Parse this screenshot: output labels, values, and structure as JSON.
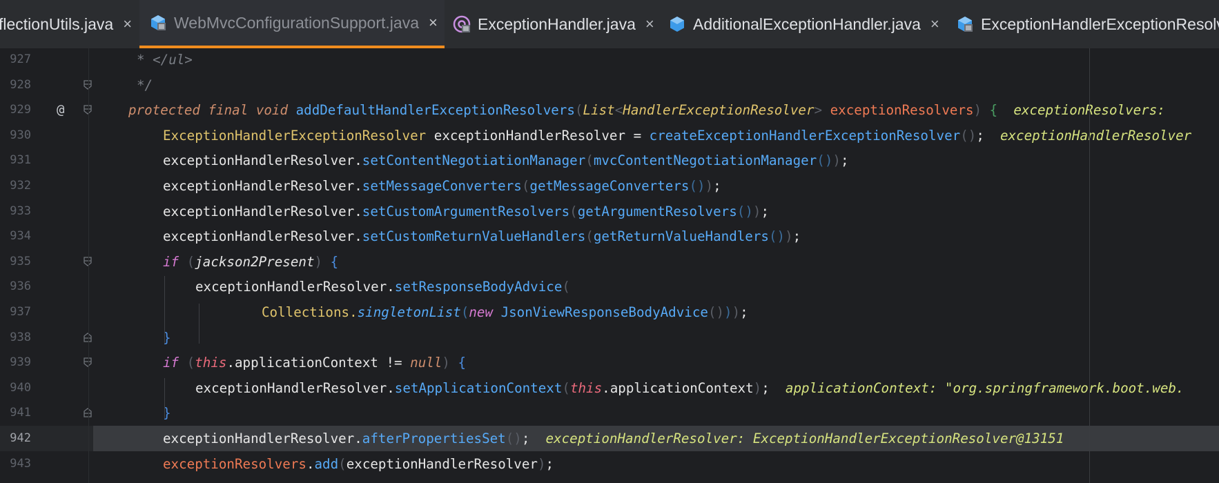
{
  "tabs": [
    {
      "label": "flectionUtils.java",
      "icon": "java-class-icon",
      "active": false
    },
    {
      "label": "WebMvcConfigurationSupport.java",
      "icon": "java-class-icon",
      "active": true
    },
    {
      "label": "ExceptionHandler.java",
      "icon": "annotation-icon",
      "active": false
    },
    {
      "label": "AdditionalExceptionHandler.java",
      "icon": "java-class-icon",
      "active": false
    },
    {
      "label": "ExceptionHandlerExceptionResolve",
      "icon": "java-class-icon",
      "active": false
    }
  ],
  "tab_close_glyph": "×",
  "colors": {
    "accent": "#f08c1e",
    "background": "#1e1f22",
    "current_line": "#393b3f"
  },
  "lines": [
    {
      "number": "927",
      "tokens": [
        [
          "comment",
          "* </ul>"
        ]
      ]
    },
    {
      "number": "928",
      "tokens": [
        [
          "comment",
          "*/"
        ]
      ]
    },
    {
      "number": "929",
      "tokens": [
        [
          "kw",
          "protected"
        ],
        [
          "",
          ""
        ],
        [
          "kw",
          " final"
        ],
        [
          "kw",
          " void"
        ],
        [
          "method",
          " addDefaultHandlerExceptionResolvers"
        ],
        [
          "paren",
          "("
        ],
        [
          "typei",
          "List"
        ],
        [
          "paren",
          "<"
        ],
        [
          "typei",
          "HandlerExceptionResolver"
        ],
        [
          "paren",
          "> "
        ],
        [
          "param",
          "exceptionResolvers"
        ],
        [
          "paren",
          ")"
        ],
        [
          "brace2",
          " {"
        ],
        [
          "inline",
          "  exceptionResolvers: "
        ]
      ]
    },
    {
      "number": "930",
      "tokens": [
        [
          "type",
          "ExceptionHandlerExceptionResolver"
        ],
        [
          "ident",
          " exceptionHandlerResolver = "
        ],
        [
          "method",
          "createExceptionHandlerExceptionResolver"
        ],
        [
          "paren",
          "()"
        ],
        [
          "ident",
          ";  "
        ],
        [
          "inline",
          "exceptionHandlerResolver"
        ]
      ]
    },
    {
      "number": "931",
      "tokens": [
        [
          "ident",
          "exceptionHandlerResolver."
        ],
        [
          "method",
          "setContentNegotiationManager"
        ],
        [
          "paren",
          "("
        ],
        [
          "method",
          "mvcContentNegotiationManager"
        ],
        [
          "paren2",
          "()"
        ],
        [
          "paren",
          ")"
        ],
        [
          "ident",
          ";"
        ]
      ]
    },
    {
      "number": "932",
      "tokens": [
        [
          "ident",
          "exceptionHandlerResolver."
        ],
        [
          "method",
          "setMessageConverters"
        ],
        [
          "paren",
          "("
        ],
        [
          "method",
          "getMessageConverters"
        ],
        [
          "paren2",
          "()"
        ],
        [
          "paren",
          ")"
        ],
        [
          "ident",
          ";"
        ]
      ]
    },
    {
      "number": "933",
      "tokens": [
        [
          "ident",
          "exceptionHandlerResolver."
        ],
        [
          "method",
          "setCustomArgumentResolvers"
        ],
        [
          "paren",
          "("
        ],
        [
          "method",
          "getArgumentResolvers"
        ],
        [
          "paren2",
          "()"
        ],
        [
          "paren",
          ")"
        ],
        [
          "ident",
          ";"
        ]
      ]
    },
    {
      "number": "934",
      "tokens": [
        [
          "ident",
          "exceptionHandlerResolver."
        ],
        [
          "method",
          "setCustomReturnValueHandlers"
        ],
        [
          "paren",
          "("
        ],
        [
          "method",
          "getReturnValueHandlers"
        ],
        [
          "paren2",
          "()"
        ],
        [
          "paren",
          ")"
        ],
        [
          "ident",
          ";"
        ]
      ]
    },
    {
      "number": "935",
      "tokens": [
        [
          "kw2",
          "if"
        ],
        [
          "paren",
          " ("
        ],
        [
          "identi",
          "jackson2Present"
        ],
        [
          "paren",
          ")"
        ],
        [
          "brace",
          " {"
        ]
      ]
    },
    {
      "number": "936",
      "tokens": [
        [
          "ident",
          "exceptionHandlerResolver."
        ],
        [
          "method",
          "setResponseBodyAdvice"
        ],
        [
          "paren",
          "("
        ]
      ]
    },
    {
      "number": "937",
      "tokens": [
        [
          "type",
          "Collections."
        ],
        [
          "methodi",
          "singletonList"
        ],
        [
          "paren2",
          "("
        ],
        [
          "kw2",
          "new"
        ],
        [
          "method",
          " JsonViewResponseBodyAdvice"
        ],
        [
          "paren",
          "()"
        ],
        [
          "paren2",
          ")"
        ],
        [
          "paren",
          ")"
        ],
        [
          "ident",
          ";"
        ]
      ]
    },
    {
      "number": "938",
      "tokens": [
        [
          "brace",
          "}"
        ]
      ]
    },
    {
      "number": "939",
      "tokens": [
        [
          "kw2",
          "if"
        ],
        [
          "paren",
          " ("
        ],
        [
          "this",
          "this"
        ],
        [
          "ident",
          ".applicationContext != "
        ],
        [
          "kw",
          "null"
        ],
        [
          "paren",
          ")"
        ],
        [
          "brace",
          " {"
        ]
      ]
    },
    {
      "number": "940",
      "tokens": [
        [
          "ident",
          "exceptionHandlerResolver."
        ],
        [
          "method",
          "setApplicationContext"
        ],
        [
          "paren",
          "("
        ],
        [
          "this",
          "this"
        ],
        [
          "ident",
          ".applicationContext"
        ],
        [
          "paren",
          ")"
        ],
        [
          "ident",
          ";  "
        ],
        [
          "inline",
          "applicationContext: \"org.springframework.boot.web."
        ]
      ]
    },
    {
      "number": "941",
      "tokens": [
        [
          "brace",
          "}"
        ]
      ]
    },
    {
      "number": "942",
      "tokens": [
        [
          "ident",
          "exceptionHandlerResolver."
        ],
        [
          "method",
          "afterPropertiesSet"
        ],
        [
          "paren",
          "()"
        ],
        [
          "ident",
          ";  "
        ],
        [
          "inline",
          "exceptionHandlerResolver: ExceptionHandlerExceptionResolver@13151"
        ]
      ]
    },
    {
      "number": "943",
      "tokens": [
        [
          "field",
          "exceptionResolvers"
        ],
        [
          "ident",
          "."
        ],
        [
          "method",
          "add"
        ],
        [
          "paren",
          "("
        ],
        [
          "ident",
          "exceptionHandlerResolver"
        ],
        [
          "paren",
          ")"
        ],
        [
          "ident",
          ";"
        ]
      ]
    }
  ]
}
